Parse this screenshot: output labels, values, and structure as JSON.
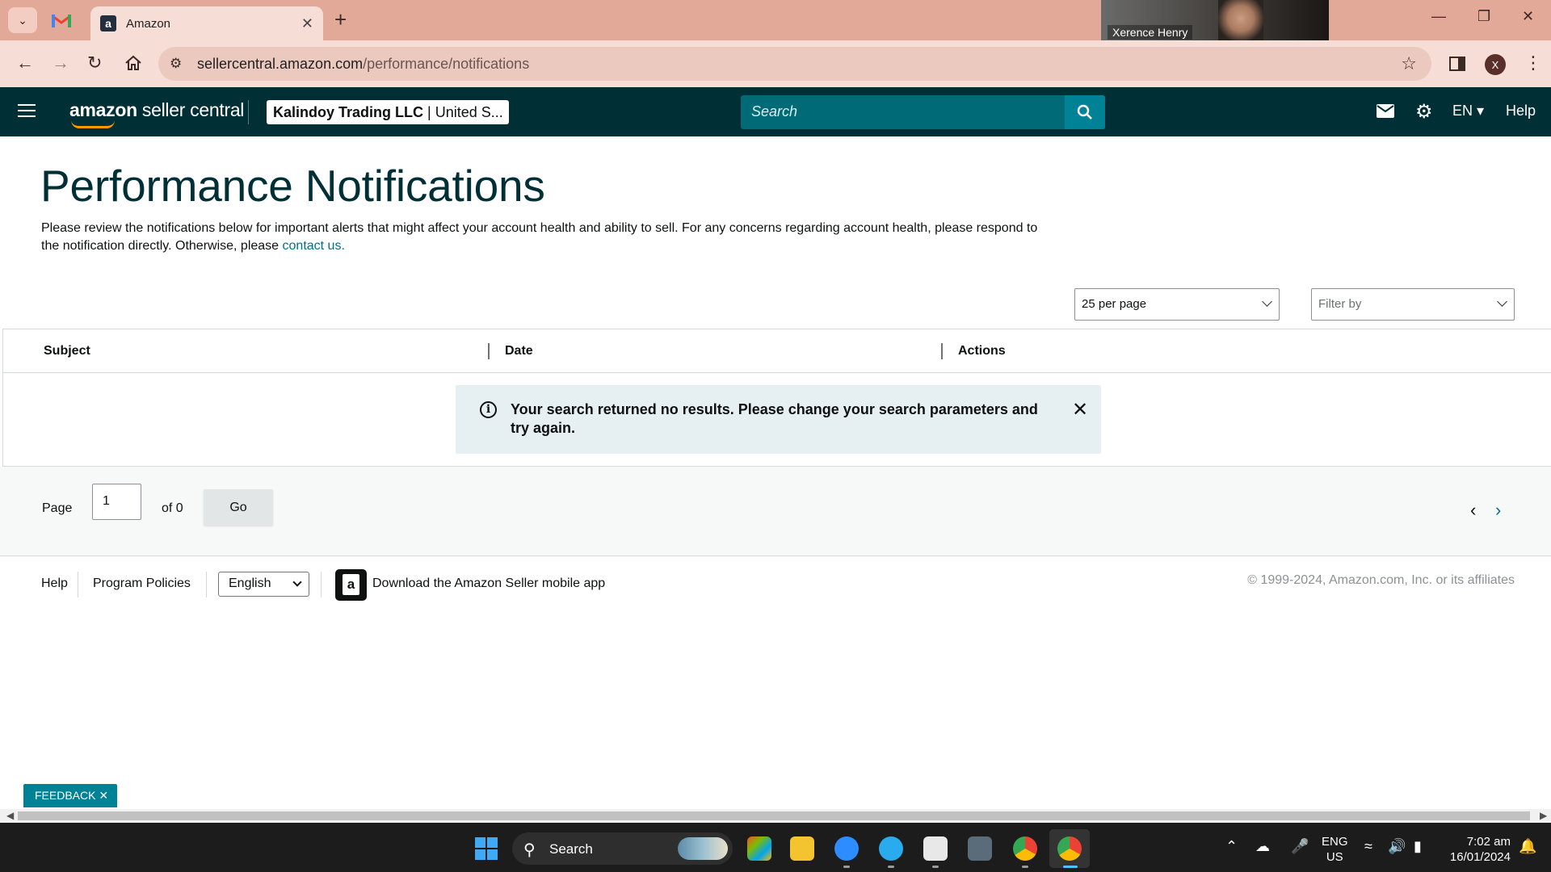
{
  "browser": {
    "tab_title": "Amazon",
    "tab_favicon": "a",
    "url_host": "sellercentral.amazon.com",
    "url_path": "/performance/notifications",
    "profile_initial": "X",
    "zoom_participant": "Xerence Henry"
  },
  "header": {
    "logo_bold": "amazon",
    "logo_rest": " seller central",
    "account_name": "Kalindoy Trading LLC",
    "account_region": " | United S...",
    "search_placeholder": "Search",
    "language": "EN",
    "help": "Help"
  },
  "page": {
    "title": "Performance Notifications",
    "description": "Please review the notifications below for important alerts that might affect your account health and ability to sell. For any concerns regarding account health, please respond to the notification directly. Otherwise, please ",
    "contact_link": "contact us.",
    "per_page": "25 per page",
    "filter_placeholder": "Filter by"
  },
  "table": {
    "columns": [
      "Subject",
      "Date",
      "Actions"
    ],
    "alert_text": "Your search returned no results. Please change your search parameters and try again."
  },
  "pager": {
    "page_label": "Page",
    "page_value": "1",
    "of_label": "of 0",
    "go_label": "Go"
  },
  "footer": {
    "help": "Help",
    "program_policies": "Program Policies",
    "language": "English",
    "download_app": "Download the Amazon Seller mobile app",
    "copyright": "© 1999-2024, Amazon.com, Inc. or its affiliates"
  },
  "feedback": {
    "label": "FEEDBACK ✕"
  },
  "taskbar": {
    "search_label": "Search",
    "lang_line1": "ENG",
    "lang_line2": "US",
    "time": "7:02 am",
    "date": "16/01/2024"
  },
  "colors": {
    "header_bg": "#002f36",
    "search_bg": "#006b76",
    "link": "#007185",
    "alert_bg": "#e6f0f2",
    "feedback_bg": "#008296",
    "browser_frame": "#e2a898"
  }
}
